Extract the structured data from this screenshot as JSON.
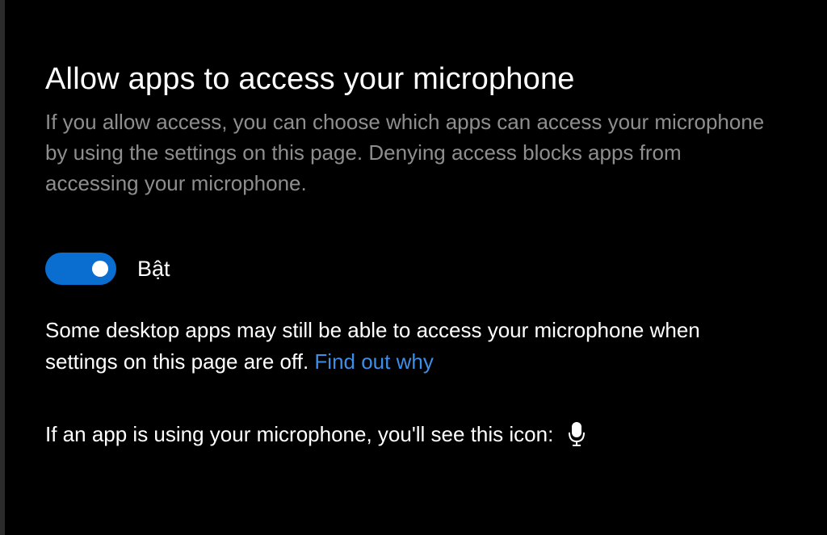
{
  "settings": {
    "title": "Allow apps to access your microphone",
    "description": "If you allow access, you can choose which apps can access your microphone by using the settings on this page. Denying access blocks apps from accessing your microphone.",
    "toggle": {
      "state": "on",
      "label": "Bật",
      "accent_color": "#0a6ed1"
    },
    "desktop_apps_note": {
      "text": "Some desktop apps may still be able to access your microphone when settings on this page are off.",
      "link_text": "Find out why",
      "link_color": "#3d8ee8"
    },
    "icon_note": {
      "text": "If an app is using your microphone, you'll see this icon:",
      "icon": "microphone-icon"
    }
  }
}
